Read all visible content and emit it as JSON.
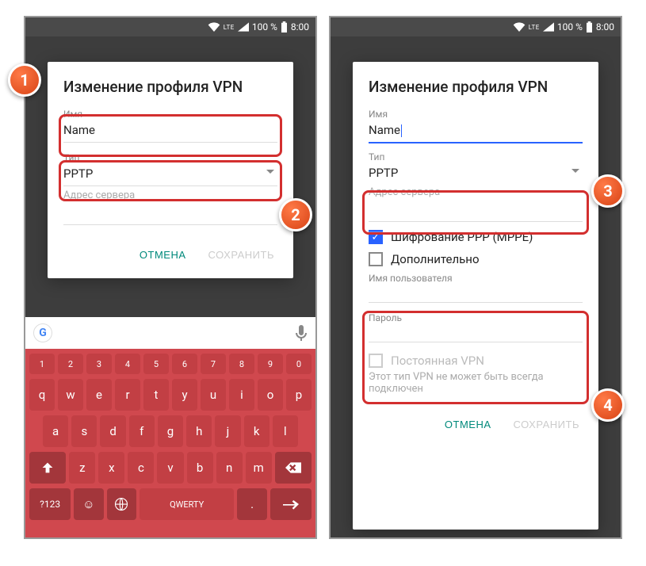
{
  "status": {
    "lte": "LTE",
    "battery": "100 %",
    "time": "8:00"
  },
  "markers": {
    "m1": "1",
    "m2": "2",
    "m3": "3",
    "m4": "4"
  },
  "dialog": {
    "title": "Изменение профиля VPN",
    "name_label": "Имя",
    "name_value": "Name",
    "type_label": "Тип",
    "type_value": "PPTP",
    "server_label": "Адрес сервера",
    "mppe_label": "Шифрование PPP (MPPE)",
    "advanced_label": "Дополнительно",
    "user_label": "Имя пользователя",
    "pass_label": "Пароль",
    "always_label": "Постоянная VPN",
    "always_helper": "Этот тип VPN не может быть всегда подключен",
    "cancel": "ОТМЕНА",
    "save": "СОХРАНИТЬ"
  },
  "keyboard": {
    "space": "QWERTY",
    "symKey": "?123",
    "numbers": [
      "1",
      "2",
      "3",
      "4",
      "5",
      "6",
      "7",
      "8",
      "9",
      "0"
    ],
    "row1": [
      "q",
      "w",
      "e",
      "r",
      "t",
      "y",
      "u",
      "i",
      "o",
      "p"
    ],
    "row2": [
      "a",
      "s",
      "d",
      "f",
      "g",
      "h",
      "j",
      "k",
      "l"
    ],
    "row3": [
      "z",
      "x",
      "c",
      "v",
      "b",
      "n",
      "m"
    ],
    "comma": ",",
    "dot": "."
  }
}
